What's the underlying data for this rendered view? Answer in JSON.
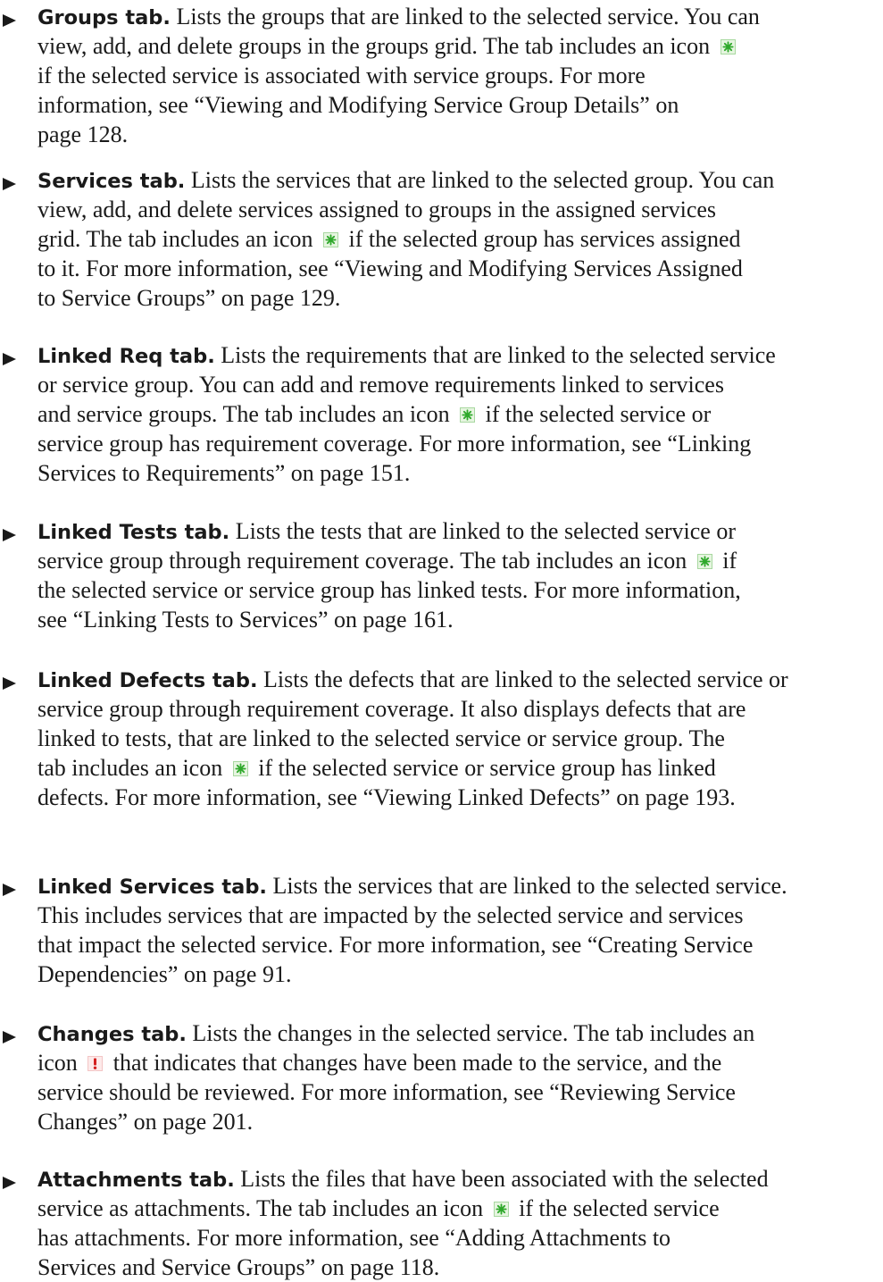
{
  "items": [
    {
      "lead": "Groups tab.",
      "lines": [
        [
          " Lists the groups that are linked to the selected service. You can"
        ],
        [
          "view, add, and delete groups in the groups grid. The tab includes an icon ",
          {
            "icon": "star-icon"
          }
        ],
        [
          "if the selected service is associated with service groups. For more"
        ],
        [
          "information, see “Viewing and Modifying Service Group Details” on"
        ],
        [
          "page 128."
        ]
      ]
    },
    {
      "lead": "Services tab.",
      "lines": [
        [
          " Lists the services that are linked to the selected group. You can"
        ],
        [
          "view, add, and delete services assigned to groups in the assigned services"
        ],
        [
          "grid. The tab includes an icon ",
          {
            "icon": "star-icon"
          },
          " if the selected group has services assigned"
        ],
        [
          "to it. For more information, see “Viewing and Modifying Services Assigned"
        ],
        [
          "to Service Groups” on page 129."
        ]
      ]
    },
    {
      "lead": "Linked Req tab.",
      "lines": [
        [
          " Lists the requirements that are linked to the selected service"
        ],
        [
          "or service group. You can add and remove requirements linked to services"
        ],
        [
          "and service groups. The tab includes an icon ",
          {
            "icon": "star-icon"
          },
          " if the selected service or"
        ],
        [
          "service group has requirement coverage. For more information, see “Linking"
        ],
        [
          "Services to Requirements” on page 151."
        ]
      ]
    },
    {
      "lead": "Linked Tests tab.",
      "lines": [
        [
          " Lists the tests that are linked to the selected service or"
        ],
        [
          "service group through requirement coverage. The tab includes an icon ",
          {
            "icon": "star-icon"
          },
          " if"
        ],
        [
          "the selected service or service group has linked tests. For more information,"
        ],
        [
          "see “Linking Tests to Services” on page 161."
        ]
      ]
    },
    {
      "lead": "Linked Defects tab.",
      "lines": [
        [
          " Lists the defects that are linked to the selected service or"
        ],
        [
          "service group through requirement coverage. It also displays defects that are"
        ],
        [
          "linked to tests, that are linked to the selected service or service group. The"
        ],
        [
          "tab includes an icon ",
          {
            "icon": "star-icon"
          },
          " if the selected service or service group has linked"
        ],
        [
          "defects. For more information, see “Viewing Linked Defects” on page 193."
        ]
      ]
    },
    {
      "lead": "Linked Services tab.",
      "lines": [
        [
          " Lists the services that are linked to the selected service."
        ],
        [
          "This includes services that are impacted by the selected service and services"
        ],
        [
          "that impact the selected service. For more information, see “Creating Service"
        ],
        [
          "Dependencies” on page 91."
        ]
      ]
    },
    {
      "lead": "Changes tab.",
      "lines": [
        [
          " Lists the changes in the selected service. The tab includes an"
        ],
        [
          "icon ",
          {
            "icon": "alert-icon"
          },
          " that indicates that changes have been made to the service, and the"
        ],
        [
          "service should be reviewed. For more information, see “Reviewing Service"
        ],
        [
          "Changes” on page 201."
        ]
      ]
    },
    {
      "lead": "Attachments tab.",
      "lines": [
        [
          " Lists the files that have been associated with the selected"
        ],
        [
          "service as attachments. The tab includes an icon ",
          {
            "icon": "star-icon"
          },
          " if the selected service"
        ],
        [
          "has attachments. For more information, see “Adding Attachments to"
        ],
        [
          "Services and Service Groups” on page 118."
        ]
      ]
    }
  ]
}
